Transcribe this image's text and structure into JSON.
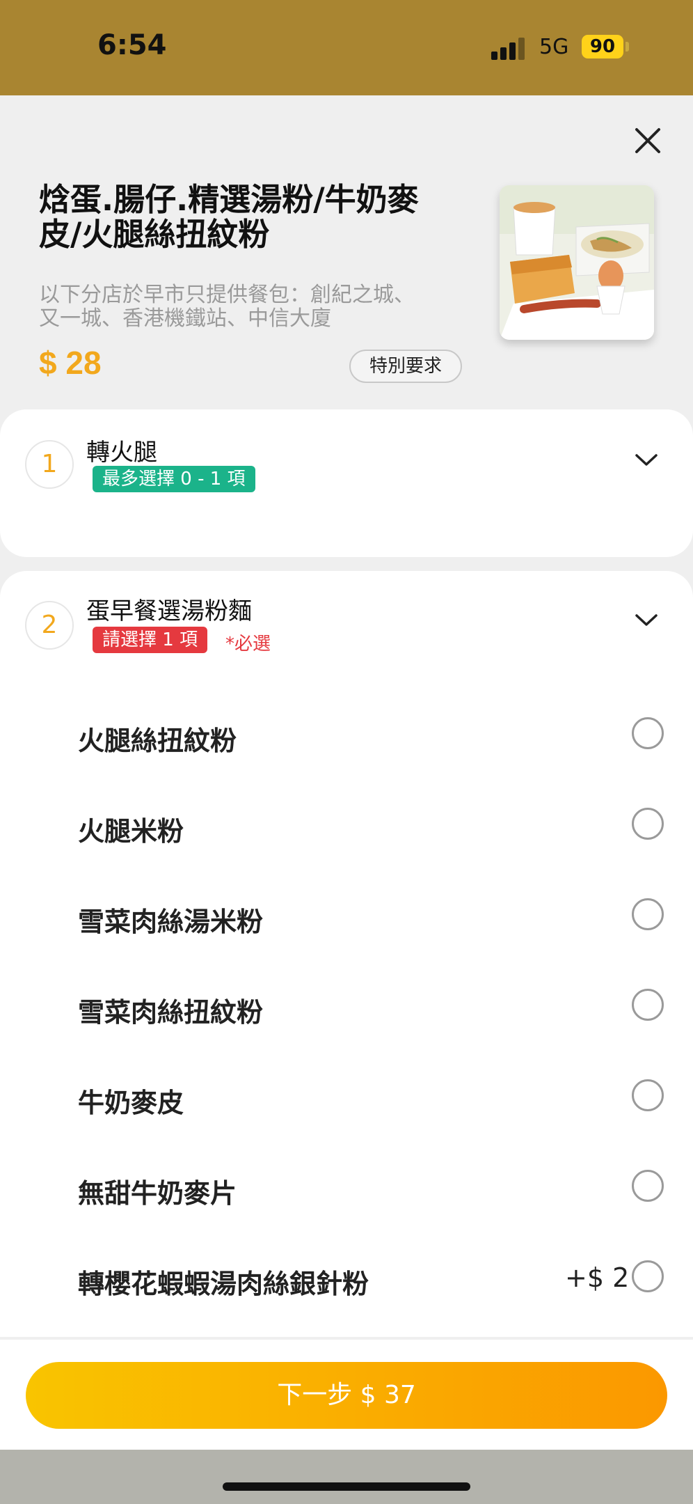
{
  "status_bar": {
    "time": "6:54",
    "network": "5G",
    "battery": "90"
  },
  "product": {
    "title": "焓蛋.腸仔.精選湯粉/牛奶麥皮/火腿絲扭紋粉",
    "notice": "以下分店於早市只提供餐包：創紀之城、又一城、香港機鐵站、中信大廈",
    "price": "$ 28",
    "special_request_label": "特別要求",
    "image_icon": "breakfast-photo"
  },
  "sections": [
    {
      "number": "1",
      "title": "轉火腿",
      "tag": "最多選擇 0 - 1 項",
      "required": ""
    },
    {
      "number": "2",
      "title": "蛋早餐選湯粉麵",
      "tag": "請選擇 1 項",
      "required": "*必選"
    }
  ],
  "options": [
    {
      "label": "火腿絲扭紋粉",
      "extra": ""
    },
    {
      "label": "火腿米粉",
      "extra": ""
    },
    {
      "label": "雪菜肉絲湯米粉",
      "extra": ""
    },
    {
      "label": "雪菜肉絲扭紋粉",
      "extra": ""
    },
    {
      "label": "牛奶麥皮",
      "extra": ""
    },
    {
      "label": "無甜牛奶麥片",
      "extra": ""
    },
    {
      "label": "轉櫻花蝦蝦湯肉絲銀針粉",
      "extra": "+$ 2"
    }
  ],
  "footer": {
    "next_label": "下一步  $ 37"
  },
  "colors": {
    "accent": "#f2a81d",
    "status_bar": "#a98531",
    "green_tag": "#1bb38a",
    "red_tag": "#e5393f"
  }
}
